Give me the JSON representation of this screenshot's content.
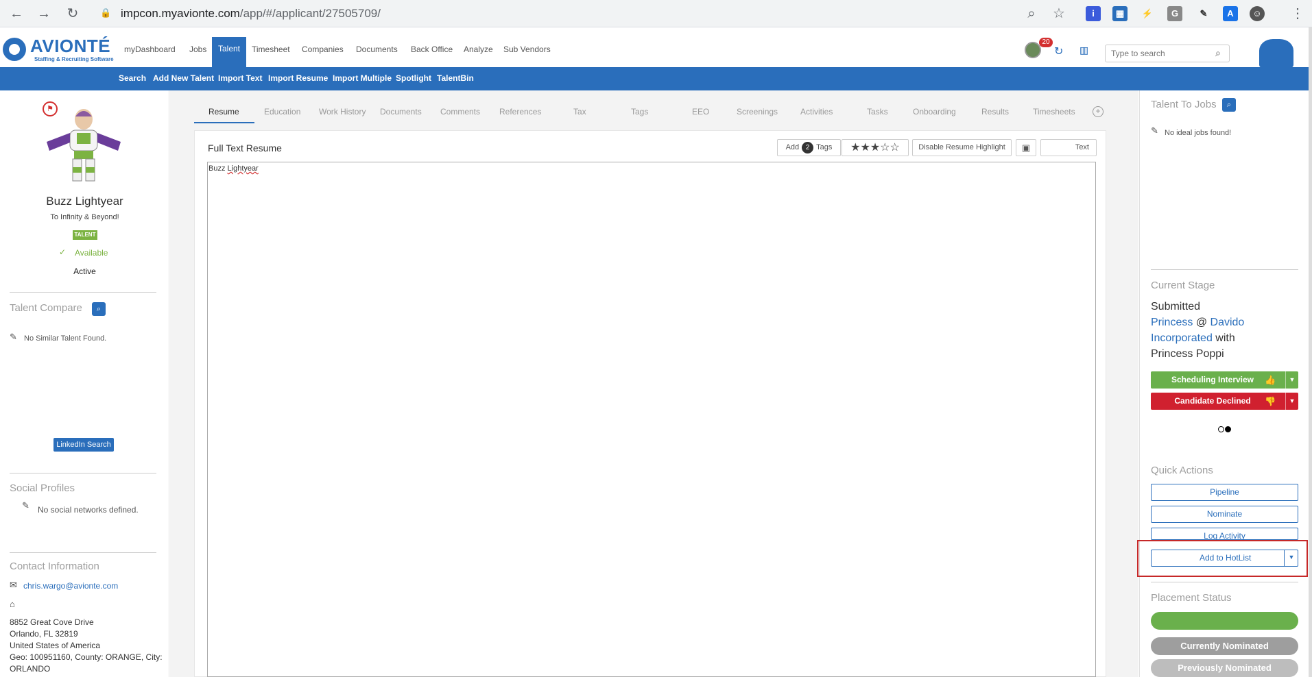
{
  "browser": {
    "url_host": "impcon.myavionte.com",
    "url_path": "/app/#/applicant/27505709/"
  },
  "app": {
    "logo": "AVIONTÉ",
    "logo_sub": "Staffing & Recruiting Software",
    "nav": [
      "myDashboard",
      "Jobs",
      "Talent",
      "Timesheet",
      "Companies",
      "Documents",
      "Back Office",
      "Analyze",
      "Sub Vendors"
    ],
    "notification_count": "20",
    "search_placeholder": "Type to search"
  },
  "subnav": [
    "Search",
    "Add New Talent",
    "Import Text",
    "Import Resume",
    "Import Multiple",
    "Spotlight",
    "TalentBin"
  ],
  "profile": {
    "name": "Buzz Lightyear",
    "tagline": "To Infinity & Beyond!",
    "badge": "TALENT",
    "availability": "Available",
    "status": "Active"
  },
  "talent_compare": {
    "title": "Talent Compare",
    "empty": "No Similar Talent Found."
  },
  "social": {
    "title": "Social Profiles",
    "empty": "No social networks defined.",
    "linkedin_button": "LinkedIn Search"
  },
  "contact": {
    "title": "Contact Information",
    "email": "chris.wargo@avionte.com",
    "address_lines": [
      "8852 Great Cove Drive",
      "Orlando, FL 32819",
      "United States of America",
      "Geo: 100951160, County: ORANGE, City:",
      "ORLANDO"
    ]
  },
  "tabs": [
    "Resume",
    "Education",
    "Work History",
    "Documents",
    "Comments",
    "References",
    "Tax",
    "Tags",
    "EEO",
    "Screenings",
    "Activities",
    "Tasks",
    "Onboarding",
    "Results",
    "Timesheets"
  ],
  "resume": {
    "title": "Full Text Resume",
    "add_label": "Add",
    "tag_count": "2",
    "tags_label": "Tags",
    "stars": "★★★☆☆",
    "disable_highlight": "Disable Resume Highlight",
    "text_button": "Text",
    "content_first": "Buzz",
    "content_second": "Lightyear"
  },
  "right": {
    "talent_to_jobs": "Talent To Jobs",
    "no_jobs": "No ideal jobs found!",
    "current_stage": "Current Stage",
    "stage_status": "Submitted",
    "job": "Princess",
    "at": "@",
    "company_1": "Davido",
    "company_2": "Incorporated",
    "with": "with",
    "contact": "Princess Poppi",
    "btn_schedule": "Scheduling Interview",
    "btn_decline": "Candidate Declined",
    "quick_actions": "Quick Actions",
    "qa_pipeline": "Pipeline",
    "qa_nominate": "Nominate",
    "qa_log": "Log Activity",
    "qa_hotlist": "Add to HotList",
    "placement_status": "Placement Status",
    "ps_current": "Currently Nominated",
    "ps_previous": "Previously Nominated"
  },
  "colors": {
    "brand": "#2a6ebb",
    "green": "#6ab04c",
    "red": "#d0202f",
    "gray_pill": "#9e9e9e"
  }
}
